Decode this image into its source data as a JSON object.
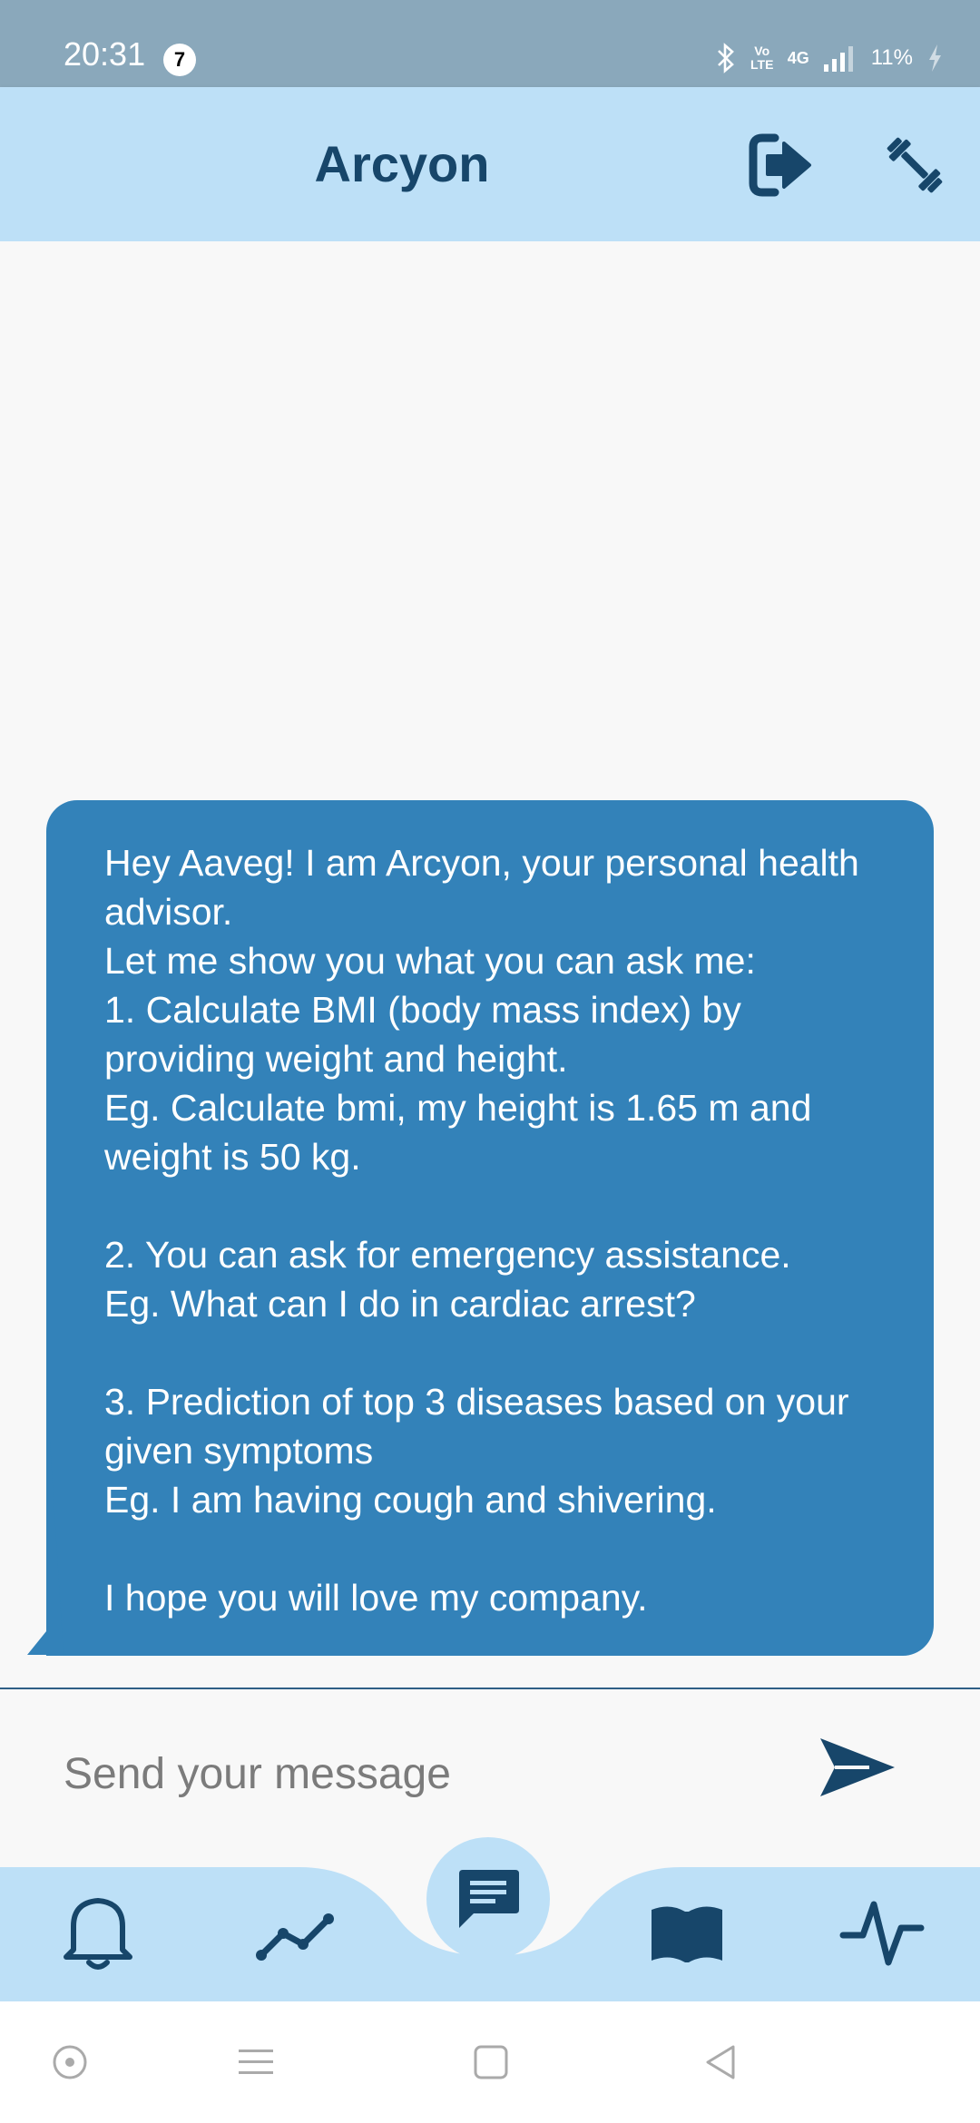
{
  "status_bar": {
    "time": "20:31",
    "notification_count": "7",
    "battery": "11%",
    "network_label": "4G",
    "volte_label": "Vo LTE"
  },
  "header": {
    "title": "Arcyon"
  },
  "chat": {
    "messages": [
      {
        "sender": "bot",
        "text": "Hey Aaveg! I am Arcyon, your personal health advisor.\nLet me show you what you can ask me:\n1. Calculate BMI (body mass index) by providing weight and height.\nEg. Calculate bmi, my height is 1.65 m and weight is 50 kg.\n\n2. You can ask for emergency assistance.\nEg. What can I do in cardiac arrest?\n\n3. Prediction of top 3 diseases based on your given symptoms\nEg. I am having cough and shivering.\n\nI hope you will love my company."
      }
    ]
  },
  "input": {
    "placeholder": "Send your message",
    "value": ""
  },
  "bottom_nav": {
    "items": [
      "bell-icon",
      "trend-icon",
      "chat-icon",
      "book-icon",
      "pulse-icon"
    ],
    "active": "chat-icon"
  },
  "colors": {
    "primary": "#17466a",
    "bubble": "#3382b9",
    "header_bg": "#bde0f7",
    "status_bar_bg": "#8aa8bb"
  }
}
